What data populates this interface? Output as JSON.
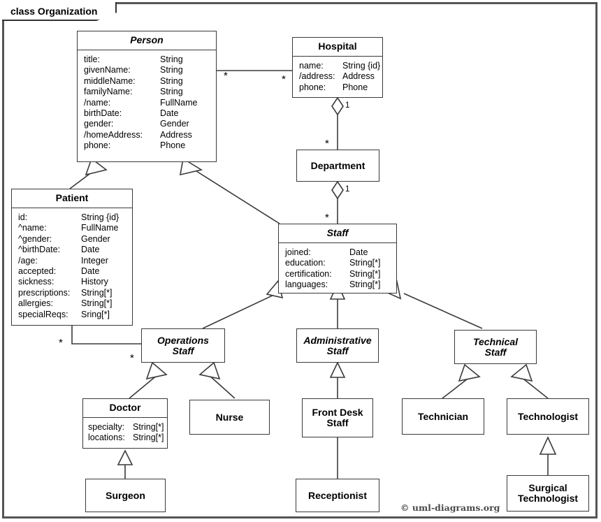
{
  "diagram": {
    "frame_label": "class Organization",
    "copyright": "© uml-diagrams.org",
    "line_color": "#3a3a3a",
    "frame_color": "#555555"
  },
  "classes": {
    "person": {
      "name": "Person",
      "attrs": [
        {
          "name": "title:",
          "type": "String"
        },
        {
          "name": "givenName:",
          "type": "String"
        },
        {
          "name": "middleName:",
          "type": "String"
        },
        {
          "name": "familyName:",
          "type": "String"
        },
        {
          "name": "/name:",
          "type": "FullName"
        },
        {
          "name": "birthDate:",
          "type": "Date"
        },
        {
          "name": "gender:",
          "type": "Gender"
        },
        {
          "name": "/homeAddress:",
          "type": "Address"
        },
        {
          "name": "phone:",
          "type": "Phone"
        }
      ]
    },
    "hospital": {
      "name": "Hospital",
      "attrs": [
        {
          "name": "name:",
          "type": "String {id}"
        },
        {
          "name": "/address:",
          "type": "Address"
        },
        {
          "name": "phone:",
          "type": "Phone"
        }
      ]
    },
    "department": {
      "name": "Department",
      "attrs": []
    },
    "patient": {
      "name": "Patient",
      "attrs": [
        {
          "name": "id:",
          "type": "String {id}"
        },
        {
          "name": "^name:",
          "type": "FullName"
        },
        {
          "name": "^gender:",
          "type": "Gender"
        },
        {
          "name": "^birthDate:",
          "type": "Date"
        },
        {
          "name": "/age:",
          "type": "Integer"
        },
        {
          "name": "accepted:",
          "type": "Date"
        },
        {
          "name": "sickness:",
          "type": "History"
        },
        {
          "name": "prescriptions:",
          "type": "String[*]"
        },
        {
          "name": "allergies:",
          "type": "String[*]"
        },
        {
          "name": "specialReqs:",
          "type": "Sring[*]"
        }
      ]
    },
    "staff": {
      "name": "Staff",
      "attrs": [
        {
          "name": "joined:",
          "type": "Date"
        },
        {
          "name": "education:",
          "type": "String[*]"
        },
        {
          "name": "certification:",
          "type": "String[*]"
        },
        {
          "name": "languages:",
          "type": "String[*]"
        }
      ]
    },
    "operations_staff": {
      "name": "Operations\nStaff",
      "attrs": []
    },
    "administrative_staff": {
      "name": "Administrative\nStaff",
      "attrs": []
    },
    "technical_staff": {
      "name": "Technical\nStaff",
      "attrs": []
    },
    "doctor": {
      "name": "Doctor",
      "attrs": [
        {
          "name": "specialty:",
          "type": "String[*]"
        },
        {
          "name": "locations:",
          "type": "String[*]"
        }
      ]
    },
    "nurse": {
      "name": "Nurse",
      "attrs": []
    },
    "front_desk_staff": {
      "name": "Front Desk\nStaff",
      "attrs": []
    },
    "technician": {
      "name": "Technician",
      "attrs": []
    },
    "technologist": {
      "name": "Technologist",
      "attrs": []
    },
    "surgeon": {
      "name": "Surgeon",
      "attrs": []
    },
    "receptionist": {
      "name": "Receptionist",
      "attrs": []
    },
    "surgical_technologist": {
      "name": "Surgical\nTechnologist",
      "attrs": []
    }
  },
  "multiplicities": {
    "person_hospital_person_end": "*",
    "person_hospital_hospital_end": "*",
    "hospital_department_hospital_end": "1",
    "hospital_department_department_end": "*",
    "department_staff_department_end": "1",
    "department_staff_staff_end": "*",
    "patient_opsstaff_patient_end": "*",
    "patient_opsstaff_opsstaff_end": "*"
  }
}
